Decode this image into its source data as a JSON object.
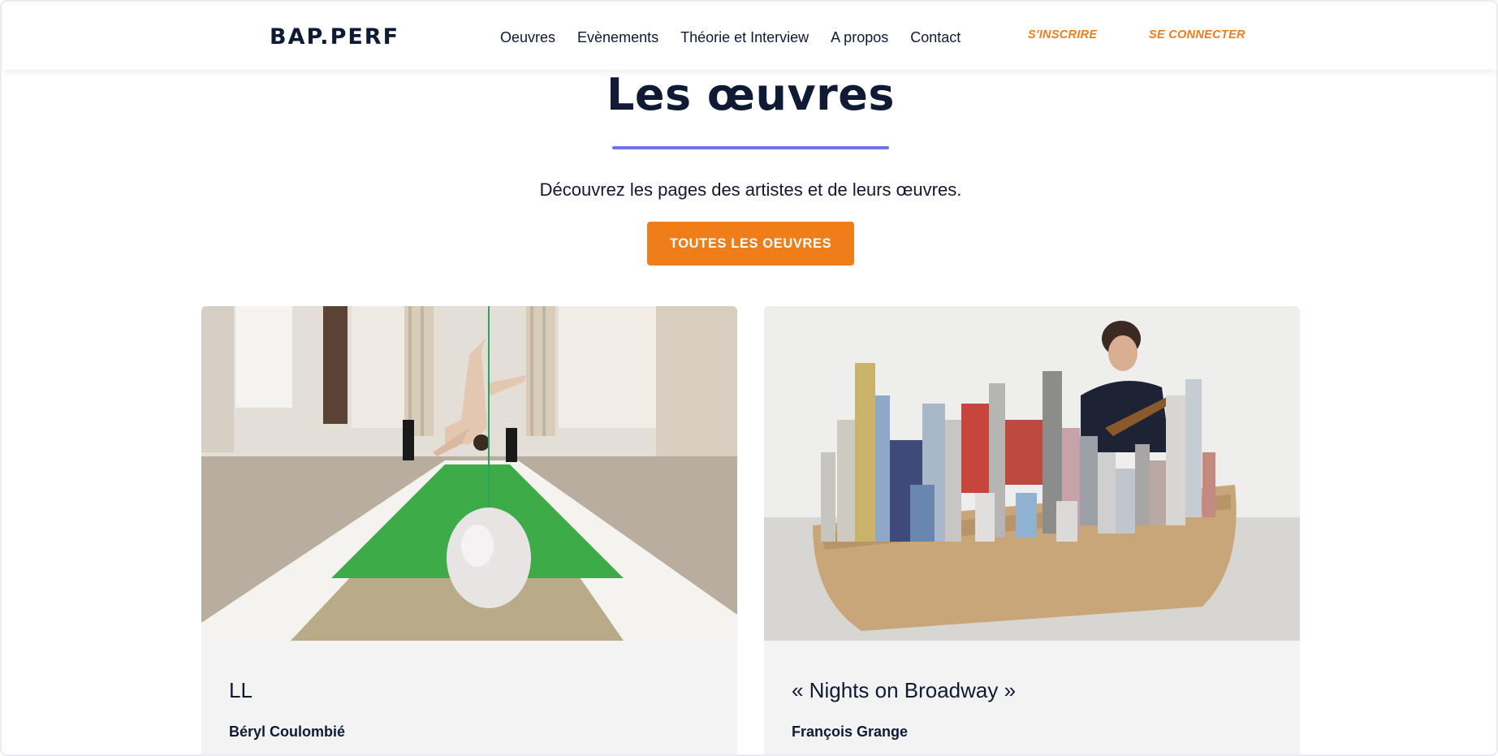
{
  "brand": {
    "logo": "BAP.PERF"
  },
  "nav": {
    "items": [
      {
        "label": "Oeuvres"
      },
      {
        "label": "Evènements"
      },
      {
        "label": "Théorie et Interview"
      },
      {
        "label": "A propos"
      },
      {
        "label": "Contact"
      }
    ],
    "signup": "S'INSCRIRE",
    "login": "SE CONNECTER"
  },
  "section": {
    "title": "Les œuvres",
    "subtitle": "Découvrez les pages des artistes et de leurs œuvres.",
    "cta": "TOUTES LES OEUVRES"
  },
  "cards": [
    {
      "title": "LL",
      "artist": "Béryl Coulombié"
    },
    {
      "title": "« Nights on Broadway »",
      "artist": "François Grange"
    }
  ],
  "colors": {
    "accent": "#ee7d1a",
    "underline": "#7173e6",
    "text": "#0f1a35",
    "card_bg": "#f3f3f3"
  }
}
